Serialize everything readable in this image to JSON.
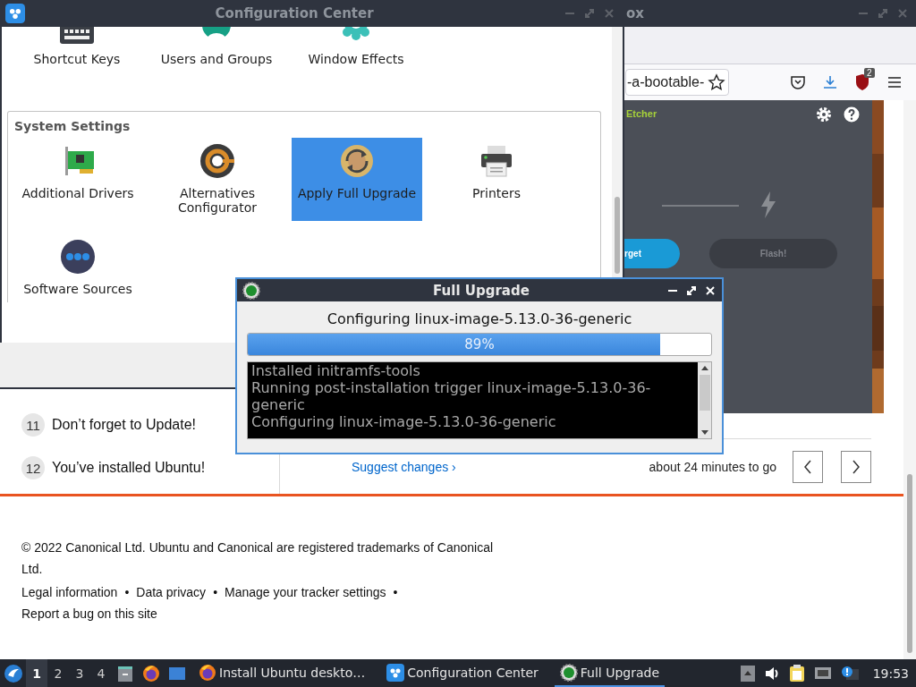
{
  "browser": {
    "title": "ox",
    "address": "-a-bootable-",
    "badge": "2",
    "page": {
      "screenshot": {
        "app_name": "Etcher",
        "target_button": "rget",
        "flash_button": "Flash!"
      },
      "steps": [
        {
          "number": "11",
          "title": "Don’t forget to Update!"
        },
        {
          "number": "12",
          "title": "You’ve installed Ubuntu!"
        }
      ],
      "suggest_link": "Suggest changes ›",
      "time_left": "about 24 minutes to go",
      "footer": {
        "copyright": "© 2022 Canonical Ltd. Ubuntu and Canonical are registered trademarks of Canonical Ltd.",
        "separator": "•",
        "links": [
          "Legal information",
          "Data privacy",
          "Manage your tracker settings",
          "Report a bug on this site"
        ]
      }
    }
  },
  "config_window": {
    "title": "Configuration Center",
    "top_items": [
      {
        "label": "Shortcut Keys",
        "selected": false
      },
      {
        "label": "Users and Groups",
        "selected": false
      },
      {
        "label": "Window Effects",
        "selected": false
      }
    ],
    "sections": [
      {
        "title": "System Settings",
        "items": [
          {
            "label": "Additional Drivers",
            "selected": false
          },
          {
            "label": "Alternatives Configurator",
            "selected": false
          },
          {
            "label": "Apply Full Upgrade",
            "selected": true
          },
          {
            "label": "Printers",
            "selected": false
          },
          {
            "label": "Software Sources",
            "selected": false
          }
        ]
      }
    ]
  },
  "dialog": {
    "title": "Full Upgrade",
    "status": "Configuring linux-image-5.13.0-36-generic",
    "level": 0.89,
    "percent": "89%",
    "log": [
      "Installed initramfs-tools",
      "Running post-installation trigger linux-image-5.13.0-36-generic",
      "Configuring linux-image-5.13.0-36-generic"
    ]
  },
  "taskbar": {
    "workspaces": [
      {
        "label": "1",
        "selected": true
      },
      {
        "label": "2",
        "selected": false
      },
      {
        "label": "3",
        "selected": false
      },
      {
        "label": "4",
        "selected": false
      }
    ],
    "tasks": [
      {
        "label": "Install Ubuntu deskto…",
        "selected": false
      },
      {
        "label": "Configuration Center",
        "selected": false
      },
      {
        "label": "Full Upgrade",
        "selected": true
      }
    ],
    "clock": "19:53"
  }
}
